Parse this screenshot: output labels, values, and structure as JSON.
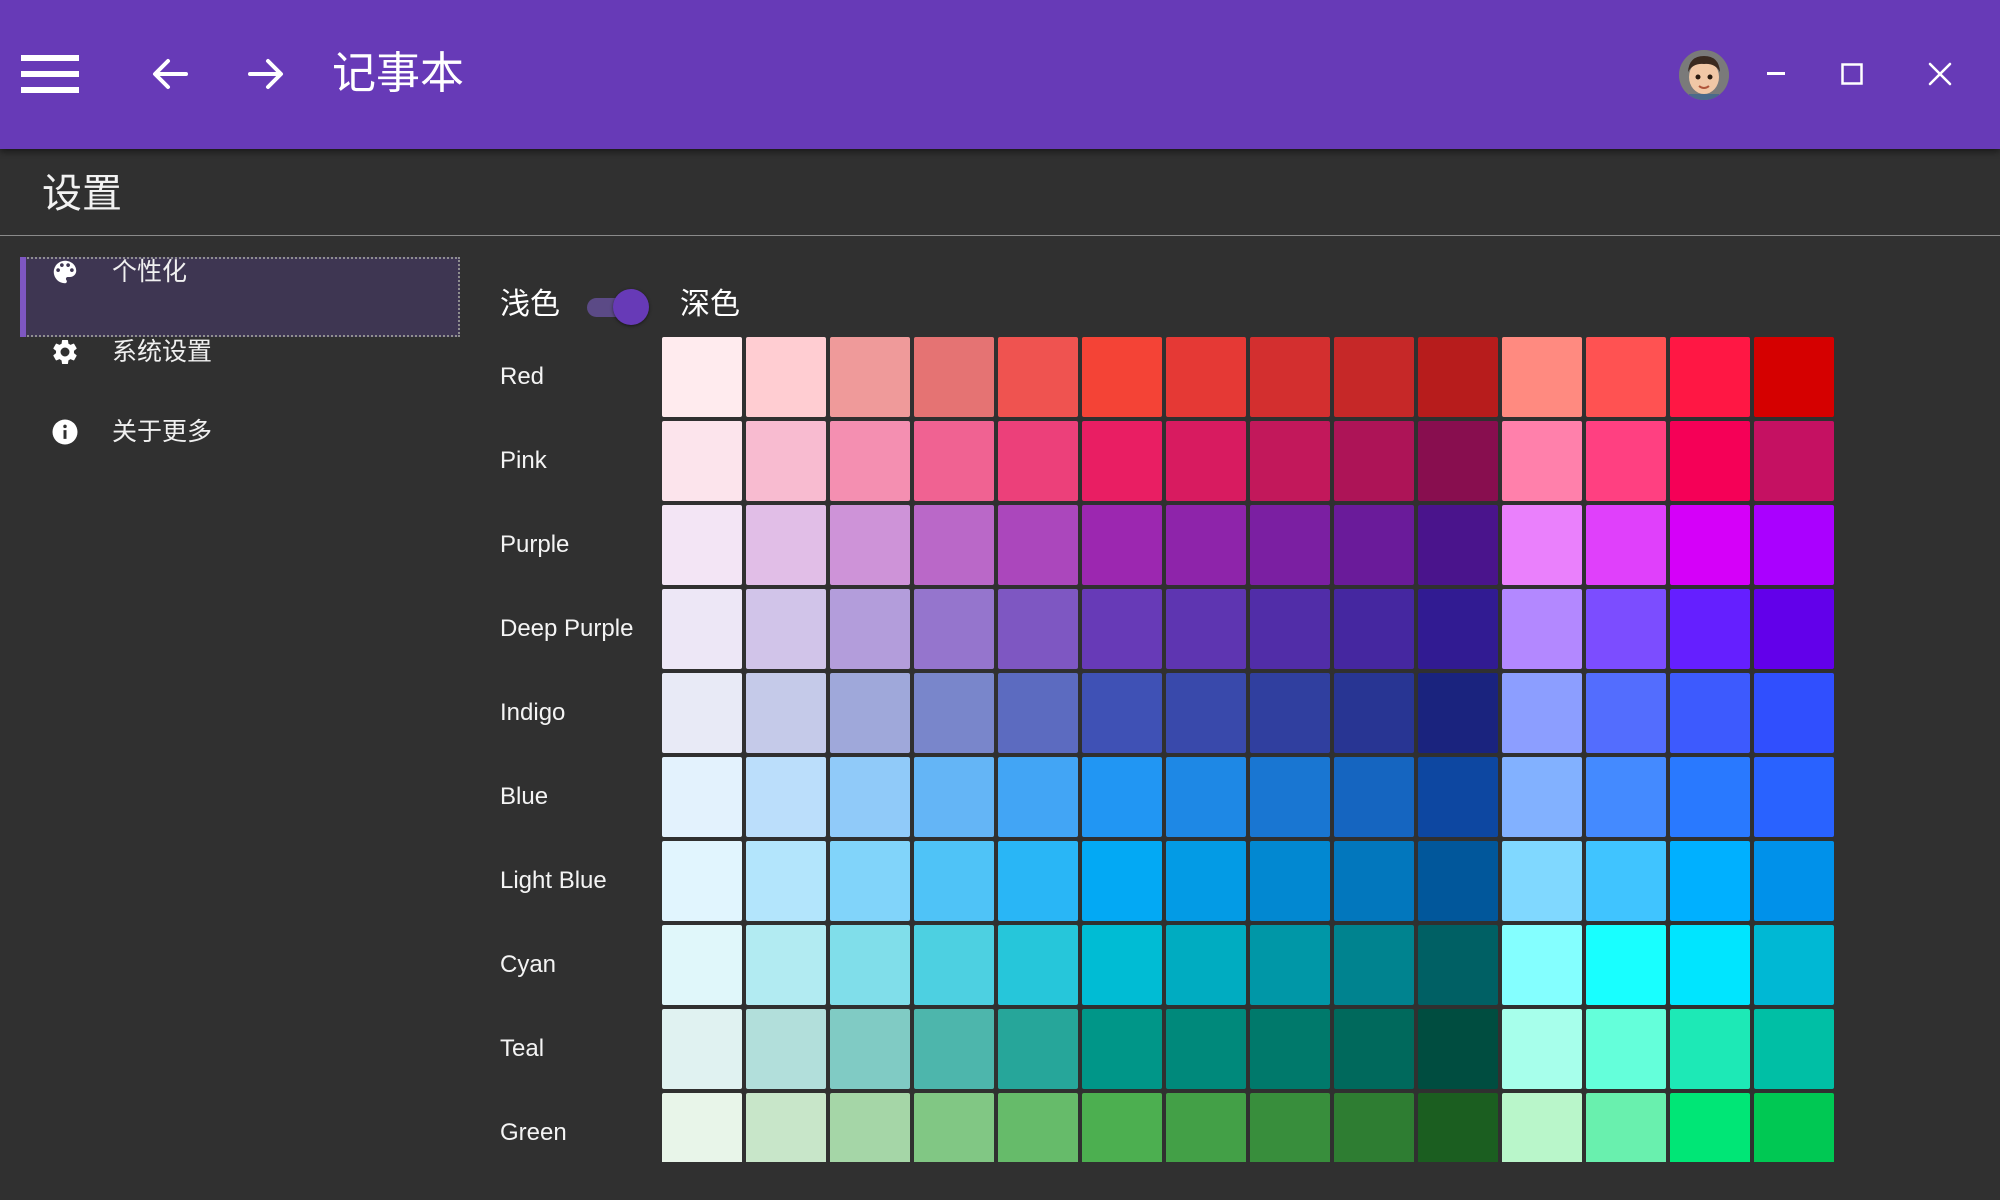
{
  "titlebar": {
    "menu_icon": "hamburger-menu-icon",
    "back_icon": "arrow-left-icon",
    "forward_icon": "arrow-right-icon",
    "title": "记事本",
    "avatar_icon": "user-avatar",
    "minimize_icon": "minimize-icon",
    "maximize_icon": "maximize-icon",
    "close_icon": "close-icon",
    "background_color": "#673ab7"
  },
  "page": {
    "title": "设置"
  },
  "sidebar": {
    "items": [
      {
        "label": "个性化",
        "icon": "palette-icon",
        "active": true
      },
      {
        "label": "系统设置",
        "icon": "gear-icon",
        "active": false
      },
      {
        "label": "关于更多",
        "icon": "info-icon",
        "active": false
      }
    ]
  },
  "theme": {
    "light_label": "浅色",
    "dark_label": "深色",
    "dark_mode_on": true
  },
  "palette": {
    "rows": [
      {
        "name": "Red",
        "colors": [
          "#ffebee",
          "#ffcdd2",
          "#ef9a9a",
          "#e57373",
          "#ef5350",
          "#f44336",
          "#e53935",
          "#d32f2f",
          "#c62828",
          "#b71c1c",
          "#ff8a80",
          "#ff5252",
          "#ff1744",
          "#d50000"
        ]
      },
      {
        "name": "Pink",
        "colors": [
          "#fce4ec",
          "#f8bbd0",
          "#f48fb1",
          "#f06292",
          "#ec407a",
          "#e91e63",
          "#d81b60",
          "#c2185b",
          "#ad1457",
          "#880e4f",
          "#ff80ab",
          "#ff4081",
          "#f50057",
          "#c51162"
        ]
      },
      {
        "name": "Purple",
        "colors": [
          "#f3e5f5",
          "#e1bee7",
          "#ce93d8",
          "#ba68c8",
          "#ab47bc",
          "#9c27b0",
          "#8e24aa",
          "#7b1fa2",
          "#6a1b9a",
          "#4a148c",
          "#ea80fc",
          "#e040fb",
          "#d500f9",
          "#aa00ff"
        ]
      },
      {
        "name": "Deep Purple",
        "colors": [
          "#ede7f6",
          "#d1c4e9",
          "#b39ddb",
          "#9575cd",
          "#7e57c2",
          "#673ab7",
          "#5e35b1",
          "#512da8",
          "#4527a0",
          "#311b92",
          "#b388ff",
          "#7c4dff",
          "#651fff",
          "#6200ea"
        ]
      },
      {
        "name": "Indigo",
        "colors": [
          "#e8eaf6",
          "#c5cae9",
          "#9fa8da",
          "#7986cb",
          "#5c6bc0",
          "#3f51b5",
          "#3949ab",
          "#303f9f",
          "#283593",
          "#1a237e",
          "#8c9eff",
          "#536dfe",
          "#3d5afe",
          "#304ffe"
        ]
      },
      {
        "name": "Blue",
        "colors": [
          "#e3f2fd",
          "#bbdefb",
          "#90caf9",
          "#64b5f6",
          "#42a5f5",
          "#2196f3",
          "#1e88e5",
          "#1976d2",
          "#1565c0",
          "#0d47a1",
          "#82b1ff",
          "#448aff",
          "#2979ff",
          "#2962ff"
        ]
      },
      {
        "name": "Light Blue",
        "colors": [
          "#e1f5fe",
          "#b3e5fc",
          "#81d4fa",
          "#4fc3f7",
          "#29b6f6",
          "#03a9f4",
          "#039be5",
          "#0288d1",
          "#0277bd",
          "#01579b",
          "#80d8ff",
          "#40c4ff",
          "#00b0ff",
          "#0091ea"
        ]
      },
      {
        "name": "Cyan",
        "colors": [
          "#e0f7fa",
          "#b2ebf2",
          "#80deea",
          "#4dd0e1",
          "#26c6da",
          "#00bcd4",
          "#00acc1",
          "#0097a7",
          "#00838f",
          "#006064",
          "#84ffff",
          "#18ffff",
          "#00e5ff",
          "#00b8d4"
        ]
      },
      {
        "name": "Teal",
        "colors": [
          "#e0f2f1",
          "#b2dfdb",
          "#80cbc4",
          "#4db6ac",
          "#26a69a",
          "#009688",
          "#00897b",
          "#00796b",
          "#00695c",
          "#004d40",
          "#a7ffeb",
          "#64ffda",
          "#1de9b6",
          "#00bfa5"
        ]
      },
      {
        "name": "Green",
        "colors": [
          "#e8f5e9",
          "#c8e6c9",
          "#a5d6a7",
          "#81c784",
          "#66bb6a",
          "#4caf50",
          "#43a047",
          "#388e3c",
          "#2e7d32",
          "#1b5e20",
          "#b9f6ca",
          "#69f0ae",
          "#00e676",
          "#00c853"
        ]
      }
    ]
  }
}
